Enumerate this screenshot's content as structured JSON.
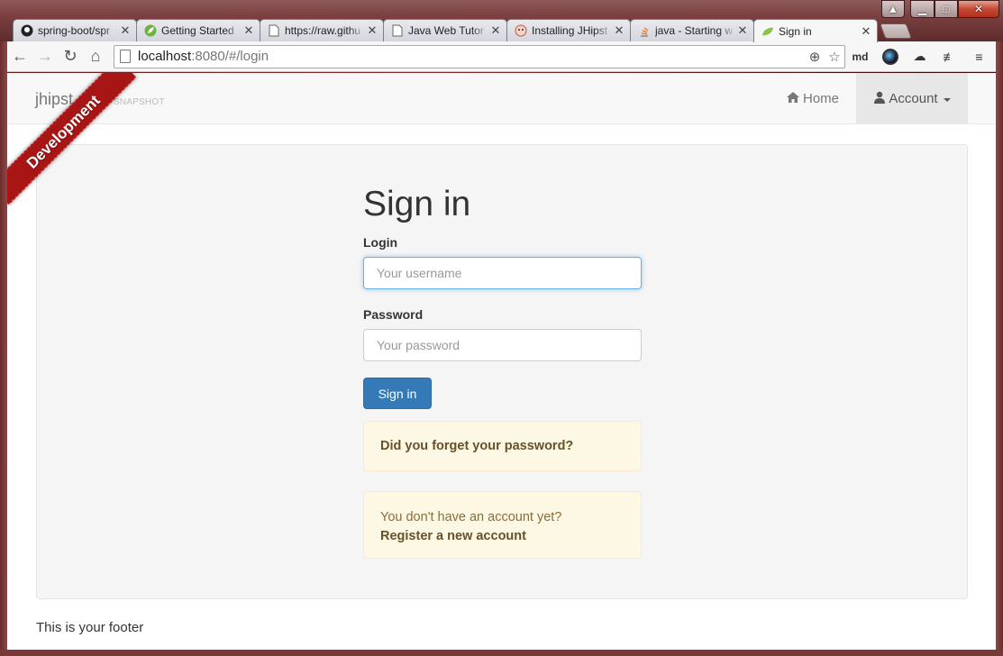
{
  "browser": {
    "tabs": [
      {
        "label": "spring-boot/spr",
        "icon": "github-icon",
        "active": false
      },
      {
        "label": "Getting Started",
        "icon": "spring-leaf-icon",
        "active": false
      },
      {
        "label": "https://raw.githu",
        "icon": "page-icon",
        "active": false
      },
      {
        "label": "Java Web Tutor",
        "icon": "page-icon",
        "active": false
      },
      {
        "label": "Installing JHipst",
        "icon": "jhipster-icon",
        "active": false
      },
      {
        "label": "java - Starting w",
        "icon": "stackoverflow-icon",
        "active": false
      },
      {
        "label": "Sign in",
        "icon": "spring-leaf-icon",
        "active": true
      }
    ],
    "address": {
      "host": "localhost",
      "rest": ":8080/#/login"
    },
    "extensions": {
      "md_label": "md"
    }
  },
  "app": {
    "brand": "jhipst",
    "version": "0.1-SNAPSHOT",
    "ribbon": "Development",
    "nav": {
      "home": "Home",
      "account": "Account"
    }
  },
  "login": {
    "title": "Sign in",
    "login_label": "Login",
    "login_placeholder": "Your username",
    "password_label": "Password",
    "password_placeholder": "Your password",
    "submit": "Sign in",
    "forgot": "Did you forget your password?",
    "no_account": "You don't have an account yet?",
    "register": "Register a new account"
  },
  "footer": {
    "text": "This is your footer"
  },
  "colors": {
    "primary": "#337ab7",
    "ribbon": "#a81515",
    "alert_bg": "#fcf8e3"
  }
}
